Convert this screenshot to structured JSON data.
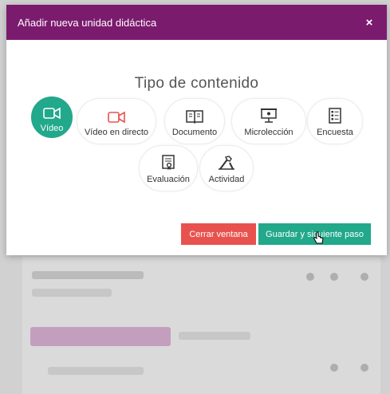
{
  "modal": {
    "title": "Añadir nueva unidad didáctica",
    "close_symbol": "×",
    "section_title": "Tipo de contenido"
  },
  "content_types": [
    {
      "label": "Vídeo",
      "icon": "video-camera-icon",
      "selected": true
    },
    {
      "label": "Vídeo en directo",
      "icon": "live-video-camera-icon",
      "selected": false
    },
    {
      "label": "Documento",
      "icon": "book-icon",
      "selected": false
    },
    {
      "label": "Microlección",
      "icon": "presentation-board-icon",
      "selected": false
    },
    {
      "label": "Encuesta",
      "icon": "checklist-icon",
      "selected": false
    },
    {
      "label": "Evaluación",
      "icon": "certificate-document-icon",
      "selected": false
    },
    {
      "label": "Actividad",
      "icon": "tools-icon",
      "selected": false
    }
  ],
  "buttons": {
    "close_window": "Cerrar ventana",
    "save_next": "Guardar y siguiente paso"
  },
  "colors": {
    "header": "#7b1b6e",
    "accent": "#22a88a",
    "danger": "#e8524e",
    "live_icon": "#e8524e"
  }
}
